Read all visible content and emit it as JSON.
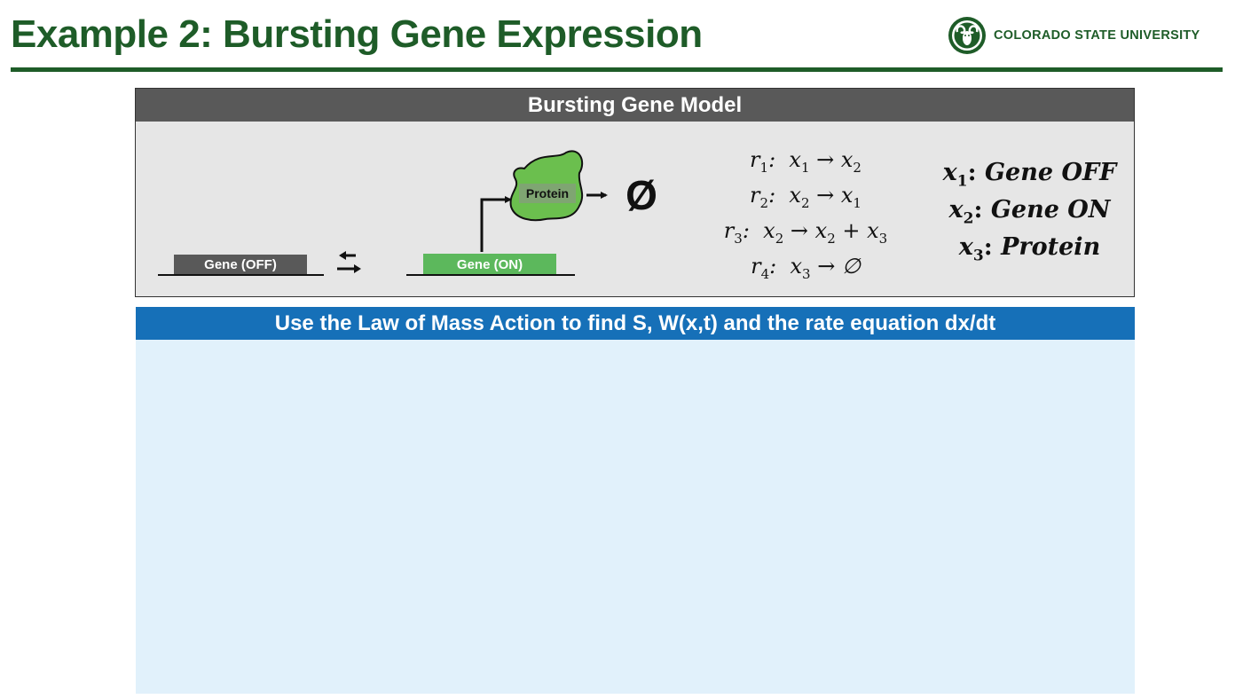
{
  "slide": {
    "title": "Example 2:  Bursting Gene Expression"
  },
  "logo": {
    "text": "COLORADO STATE UNIVERSITY"
  },
  "model": {
    "header": "Bursting Gene Model",
    "gene_off_label": "Gene (OFF)",
    "gene_on_label": "Gene (ON)",
    "protein_label": "Protein",
    "degradation_symbol": "Ø"
  },
  "reactions": [
    {
      "rate": "r",
      "rate_sub": "1",
      "lhs": "x",
      "lhs_sub": "1",
      "rhs": "x",
      "rhs_sub": "2",
      "extra": "",
      "extra_sub": ""
    },
    {
      "rate": "r",
      "rate_sub": "2",
      "lhs": "x",
      "lhs_sub": "2",
      "rhs": "x",
      "rhs_sub": "1",
      "extra": "",
      "extra_sub": ""
    },
    {
      "rate": "r",
      "rate_sub": "3",
      "lhs": "x",
      "lhs_sub": "2",
      "rhs": "x",
      "rhs_sub": "2",
      "extra": "x",
      "extra_sub": "3"
    },
    {
      "rate": "r",
      "rate_sub": "4",
      "lhs": "x",
      "lhs_sub": "3",
      "rhs": "∅",
      "rhs_sub": "",
      "extra": "",
      "extra_sub": ""
    }
  ],
  "definitions": [
    {
      "var": "x",
      "sub": "1",
      "label": "Gene OFF"
    },
    {
      "var": "x",
      "sub": "2",
      "label": "Gene ON"
    },
    {
      "var": "x",
      "sub": "3",
      "label": "Protein"
    }
  ],
  "task": {
    "header": "Use the Law of Mass Action to find S, W(x,t) and the rate equation dx/dt"
  },
  "colors": {
    "csu_green": "#1e5c28",
    "header_gray": "#595959",
    "task_blue": "#1670b8",
    "task_bg": "#e1f1fb",
    "gene_on_green": "#5cb85c",
    "protein_green": "#6bbf4e"
  }
}
